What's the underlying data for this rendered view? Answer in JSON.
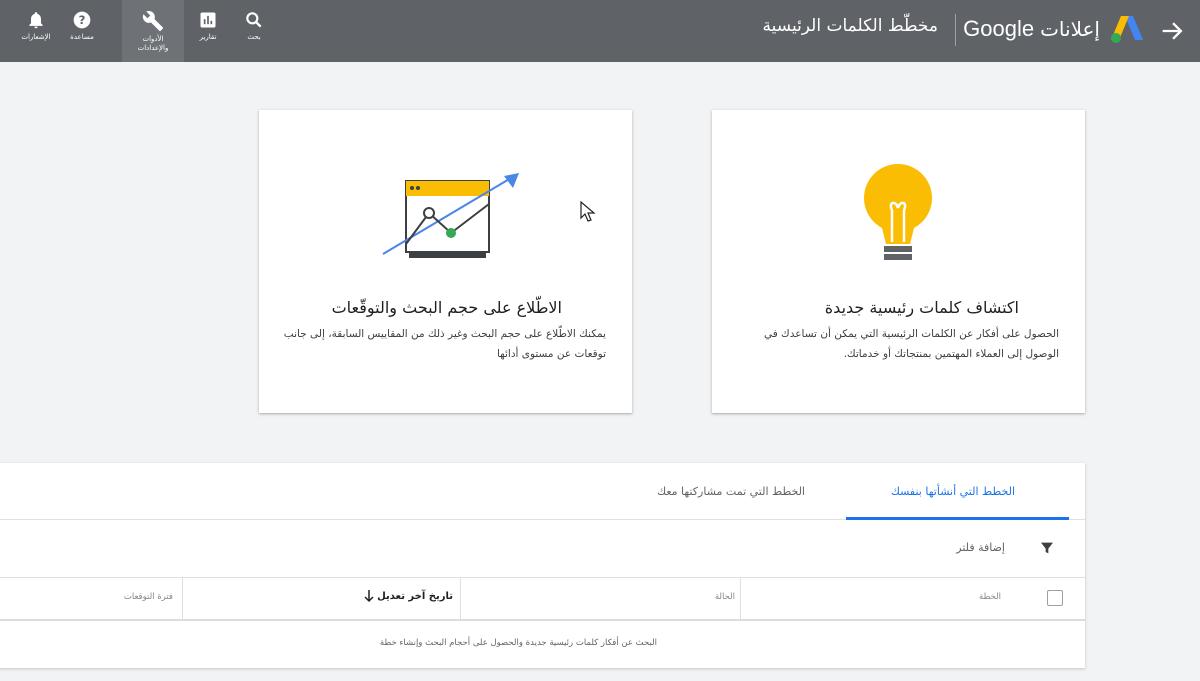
{
  "header": {
    "back_icon": "arrow-forward-icon",
    "brand_ads": "إعلانات",
    "brand_google": "Google",
    "page_title": "مخطّط الكلمات الرئيسية",
    "nav": {
      "search": "بحث",
      "reports": "تقارير",
      "tools": "الأدوات والإعدادات",
      "help": "مساعدة",
      "notifications": "الإشعارات"
    }
  },
  "cards": {
    "discover": {
      "title": "اكتشاف كلمات رئيسية جديدة",
      "description": "الحصول على أفكار عن الكلمات الرئيسية التي يمكن أن تساعدك في الوصول إلى العملاء المهتمين بمنتجاتك أو خدماتك.",
      "icon": "lightbulb-icon"
    },
    "forecast": {
      "title": "الاطّلاع على حجم البحث والتوقّعات",
      "description": "يمكنك الاطّلاع على حجم البحث وغير ذلك من المقاييس السابقة، إلى جانب توقعات عن مستوى أدائها",
      "icon": "trend-chart-icon"
    }
  },
  "plans": {
    "tabs": [
      {
        "label": "الخطط التي أنشأتها بنفسك",
        "active": true
      },
      {
        "label": "الخطط التي تمت مشاركتها معك",
        "active": false
      }
    ],
    "add_filter": "إضافة فلتر",
    "columns": {
      "plan": "الخطة",
      "status": "الحالة",
      "last_modified": "تاريخ آخر تعديل",
      "forecast_period": "فترة التوقعات"
    },
    "empty_message": "البحث عن أفكار كلمات رئيسية جديدة والحصول على أحجام البحث وإنشاء خطة"
  },
  "colors": {
    "header_bg": "#5f6368",
    "accent": "#1a73e8",
    "bulb_yellow": "#fbbc04",
    "chart_green": "#34a853"
  }
}
